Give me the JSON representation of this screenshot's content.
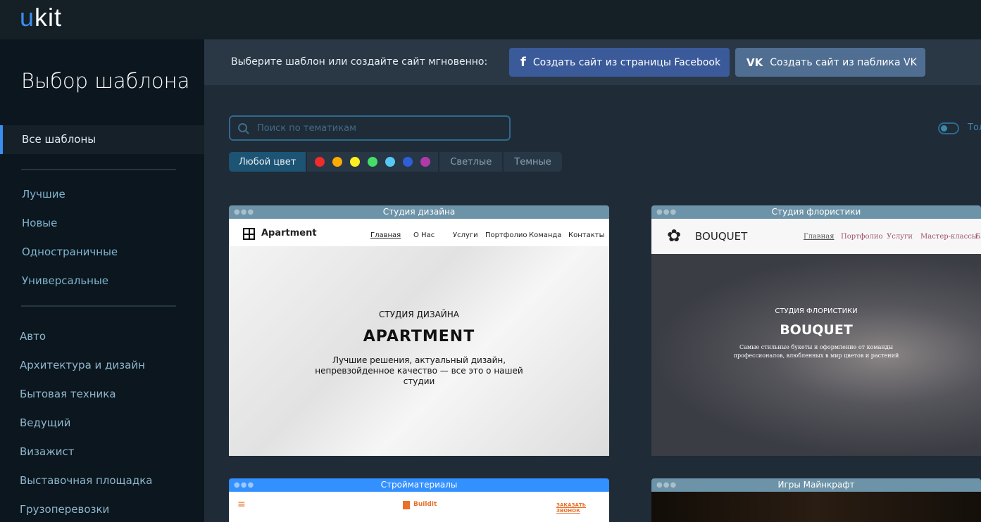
{
  "header": {
    "logo_u": "u",
    "logo_kit": "kit"
  },
  "sidebar": {
    "title": "Выбор шаблона",
    "all": "Все шаблоны",
    "groups": [
      "Лучшие",
      "Новые",
      "Одностраничные",
      "Универсальные"
    ],
    "categories": [
      "Авто",
      "Архитектура и дизайн",
      "Бытовая техника",
      "Ведущий",
      "Визажист",
      "Выставочная площадка",
      "Грузоперевозки"
    ]
  },
  "banner": {
    "text": "Выберите шаблон или создайте сайт мгновенно:",
    "facebook": "Создать сайт из страницы Facebook",
    "vk": "Создать сайт из паблика VK"
  },
  "search": {
    "placeholder": "Поиск по тематикам"
  },
  "filters": {
    "any": "Любой цвет",
    "colors": [
      "#f02b2b",
      "#ffaa00",
      "#ffee22",
      "#44dd66",
      "#55c8f5",
      "#2e5fd8",
      "#b03aa8"
    ],
    "light": "Светлые",
    "dark": "Темные"
  },
  "toggle": {
    "label": "Тол"
  },
  "cards": [
    {
      "title": "Студия дизайна",
      "brand": "Apartment",
      "nav": [
        "Главная",
        "О Нас",
        "Услуги",
        "Портфолио",
        "Команда",
        "Контакты"
      ],
      "subtitle": "СТУДИЯ ДИЗАЙНА",
      "heading": "APARTMENT",
      "text": "Лучшие решения, актуальный дизайн, непревзойденное качество — все это о нашей студии"
    },
    {
      "title": "Студия флористики",
      "brand": "BOUQUET",
      "nav": [
        "Главная",
        "Портфолио",
        "Услуги",
        "Мастер-классы",
        "Бл"
      ],
      "subtitle": "СТУДИЯ ФЛОРИСТИКИ",
      "heading": "BOUQUET",
      "text": "Самые стильные букеты и оформление от команды профессионалов, влюбленных в мир цветов и растений"
    },
    {
      "title": "Стройматериалы",
      "brand": "Buildit",
      "cta": "ЗАКАЗАТЬ ЗВОНОК"
    },
    {
      "title": "Игры Майнкрафт"
    }
  ]
}
